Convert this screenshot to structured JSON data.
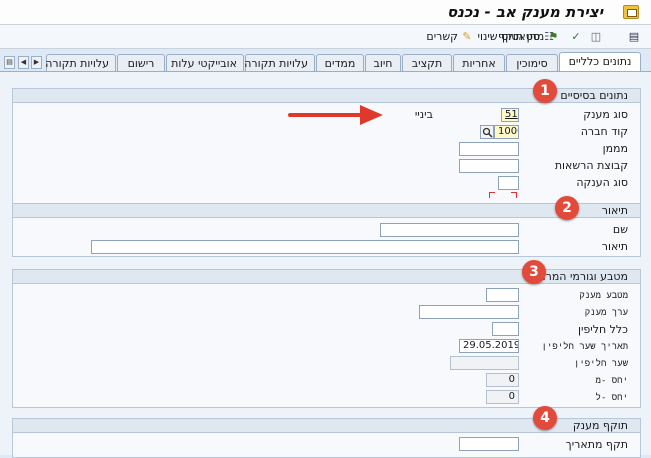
{
  "window": {
    "title": "יצירת מענק אב - נכנס"
  },
  "toolbar": {
    "items": [
      {
        "label": "מתן תוקף",
        "icon": "validate-icon"
      },
      {
        "label": "סטאטוס שינוי",
        "icon": "status-change-icon"
      },
      {
        "label": "קשרים",
        "icon": "relationships-icon"
      }
    ]
  },
  "tabs": [
    {
      "label": "נתונים כלליים",
      "active": true
    },
    {
      "label": "סימוכין"
    },
    {
      "label": "אחריות"
    },
    {
      "label": "תקציב"
    },
    {
      "label": "חיוב"
    },
    {
      "label": "ממדים"
    },
    {
      "label": "עלויות תקורה"
    },
    {
      "label": "אובייקטי עלות"
    },
    {
      "label": "רישום"
    },
    {
      "label": "עלויות תקורה"
    }
  ],
  "groups": {
    "basic": {
      "title": "נתונים בסיסיים",
      "badge": "1",
      "grant_type_label": "סוג מענק",
      "grant_type_value": "51",
      "grant_type_text": "ביניי",
      "company_code_label": "קוד חברה",
      "company_code_value": "1000",
      "sponsor_label": "מממן",
      "sponsor_value": "",
      "authorization_group_label": "קבוצת הרשאות",
      "authorization_group_value": "",
      "award_type_label": "סוג הענקה",
      "award_type_value": ""
    },
    "description": {
      "title": "תיאור",
      "badge": "2",
      "name_label": "שם",
      "name_value": "",
      "desc_label": "תיאור",
      "desc_value": ""
    },
    "currency": {
      "title": "מטבע וגורמי המרה",
      "badge": "3",
      "grant_currency_label": "מטבע מענק",
      "grant_currency_value": "",
      "grant_value_label": "ערך מענק",
      "grant_value_value": "",
      "exchange_rule_label": "כלל חליפין",
      "exchange_rule_value": "",
      "exchange_date_label": "תאריך שער חליפין",
      "exchange_date_value": "29.05.2019",
      "exchange_rate_label": "שער חליפין",
      "exchange_rate_value": "",
      "ratio_from_label": "יחס -מ",
      "ratio_from_value": "0",
      "ratio_to_label": "יחס -ל",
      "ratio_to_value": "0"
    },
    "validity": {
      "title": "תוקף מענק",
      "badge": "4",
      "valid_from_label": "תקף מתאריך",
      "valid_from_value": ""
    }
  },
  "colors": {
    "badge": "#e24b3b",
    "arrow": "#e0392b",
    "required_field": "#fff8c8"
  }
}
